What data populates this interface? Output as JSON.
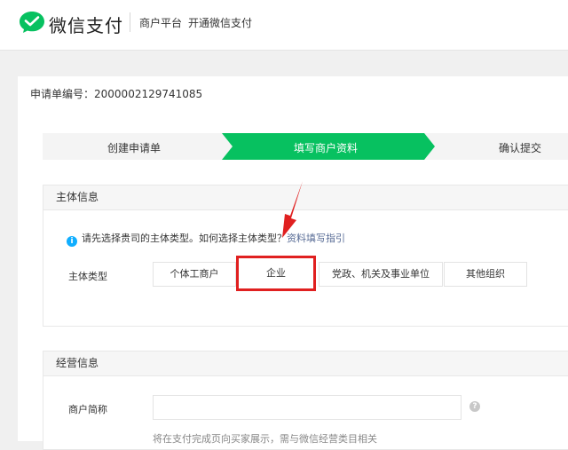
{
  "header": {
    "brand": "微信支付",
    "nav": [
      "商户平台",
      "开通微信支付"
    ]
  },
  "application": {
    "label": "申请单编号：",
    "number": "2000002129741085"
  },
  "steps": [
    {
      "label": "创建申请单",
      "active": false
    },
    {
      "label": "填写商户资料",
      "active": true
    },
    {
      "label": "确认提交",
      "active": false
    }
  ],
  "subject_section": {
    "title": "主体信息",
    "tip_text": "请先选择贵司的主体类型。如何选择主体类型",
    "tip_sep": "？",
    "tip_link": "资料填写指引",
    "field_label": "主体类型",
    "options": [
      "个体工商户",
      "企业",
      "党政、机关及事业单位",
      "其他组织"
    ],
    "selected_option": "企业"
  },
  "business_section": {
    "title": "经营信息",
    "field_label": "商户简称",
    "input_value": "",
    "input_placeholder": "",
    "hint": "将在支付完成页向买家展示，需与微信经营类目相关"
  },
  "colors": {
    "brand_green": "#07c160",
    "annotation_red": "#e02020",
    "info_blue": "#10aeff",
    "link_blue": "#576b95"
  },
  "icons": [
    "wechat-pay-logo-icon",
    "info-icon",
    "help-icon",
    "annotation-arrow"
  ]
}
